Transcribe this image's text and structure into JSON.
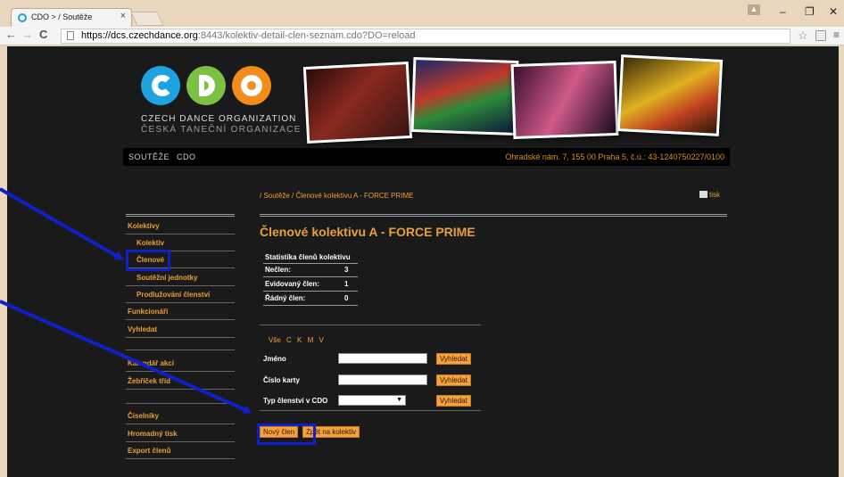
{
  "browser": {
    "tab_title": "CDO > / Soutěže",
    "tab_close": "×",
    "back": "←",
    "forward": "→",
    "reload": "C",
    "url_host": "https://dcs.czechdance.org",
    "url_rest": ":8443/kolektiv-detail-clen-seznam.cdo?DO=reload",
    "star": "☆",
    "menu": "≡",
    "minimize": "–",
    "maximize": "❐",
    "close": "✕",
    "user": "▲"
  },
  "header": {
    "logo_line1": "CZECH DANCE ORGANIZATION",
    "logo_line2": "ČESKÁ TANEČNÍ ORGANIZACE",
    "logo_colors": [
      "#1ea2e0",
      "#7cc242",
      "#f28c1c"
    ],
    "photos": [
      "#7a1f1f",
      "#2a3f8a",
      "#5a2a6a",
      "#b38a1a"
    ]
  },
  "topnav": {
    "items": [
      "SOUTĚŽE",
      "CDO"
    ],
    "address": "Ohradské nám. 7, 155 00 Praha 5, č.ú.: 43-1240750227/0100"
  },
  "breadcrumb": "/ Soutěže / Členové kolektivu A - FORCE PRIME",
  "print_label": "tisk",
  "sidebar": {
    "items": [
      {
        "label": "Kolektivy"
      },
      {
        "label": "Kolektiv"
      },
      {
        "label": "Členové"
      },
      {
        "label": "Soutěžní jednotky"
      },
      {
        "label": "Prodlužování členství"
      },
      {
        "label": "Funkcionáři"
      },
      {
        "label": "Vyhledat"
      },
      {
        "label": "Kalendář akcí"
      },
      {
        "label": "Žebříček tříd"
      },
      {
        "label": "Číselníky"
      },
      {
        "label": "Hromadný tisk"
      },
      {
        "label": "Export členů"
      }
    ]
  },
  "main": {
    "title": "Členové kolektivu A - FORCE PRIME",
    "stats": {
      "header": "Statistika členů kolektivu",
      "rows": [
        {
          "label": "Nečlen:",
          "value": "3"
        },
        {
          "label": "Evidovaný člen:",
          "value": "1"
        },
        {
          "label": "Řádný člen:",
          "value": "0"
        }
      ]
    },
    "filter_letters": "Vše C K M V",
    "form": {
      "name_label": "Jméno",
      "card_label": "Číslo karty",
      "type_label": "Typ členství v CDO",
      "search_label": "Vyhledat",
      "name_value": "",
      "card_value": "",
      "type_value": "",
      "select_arrow": "▼"
    },
    "buttons": {
      "new_member": "Nový člen",
      "back": "Zpět na kolektiv"
    }
  },
  "annotation_color": "#1020c8"
}
